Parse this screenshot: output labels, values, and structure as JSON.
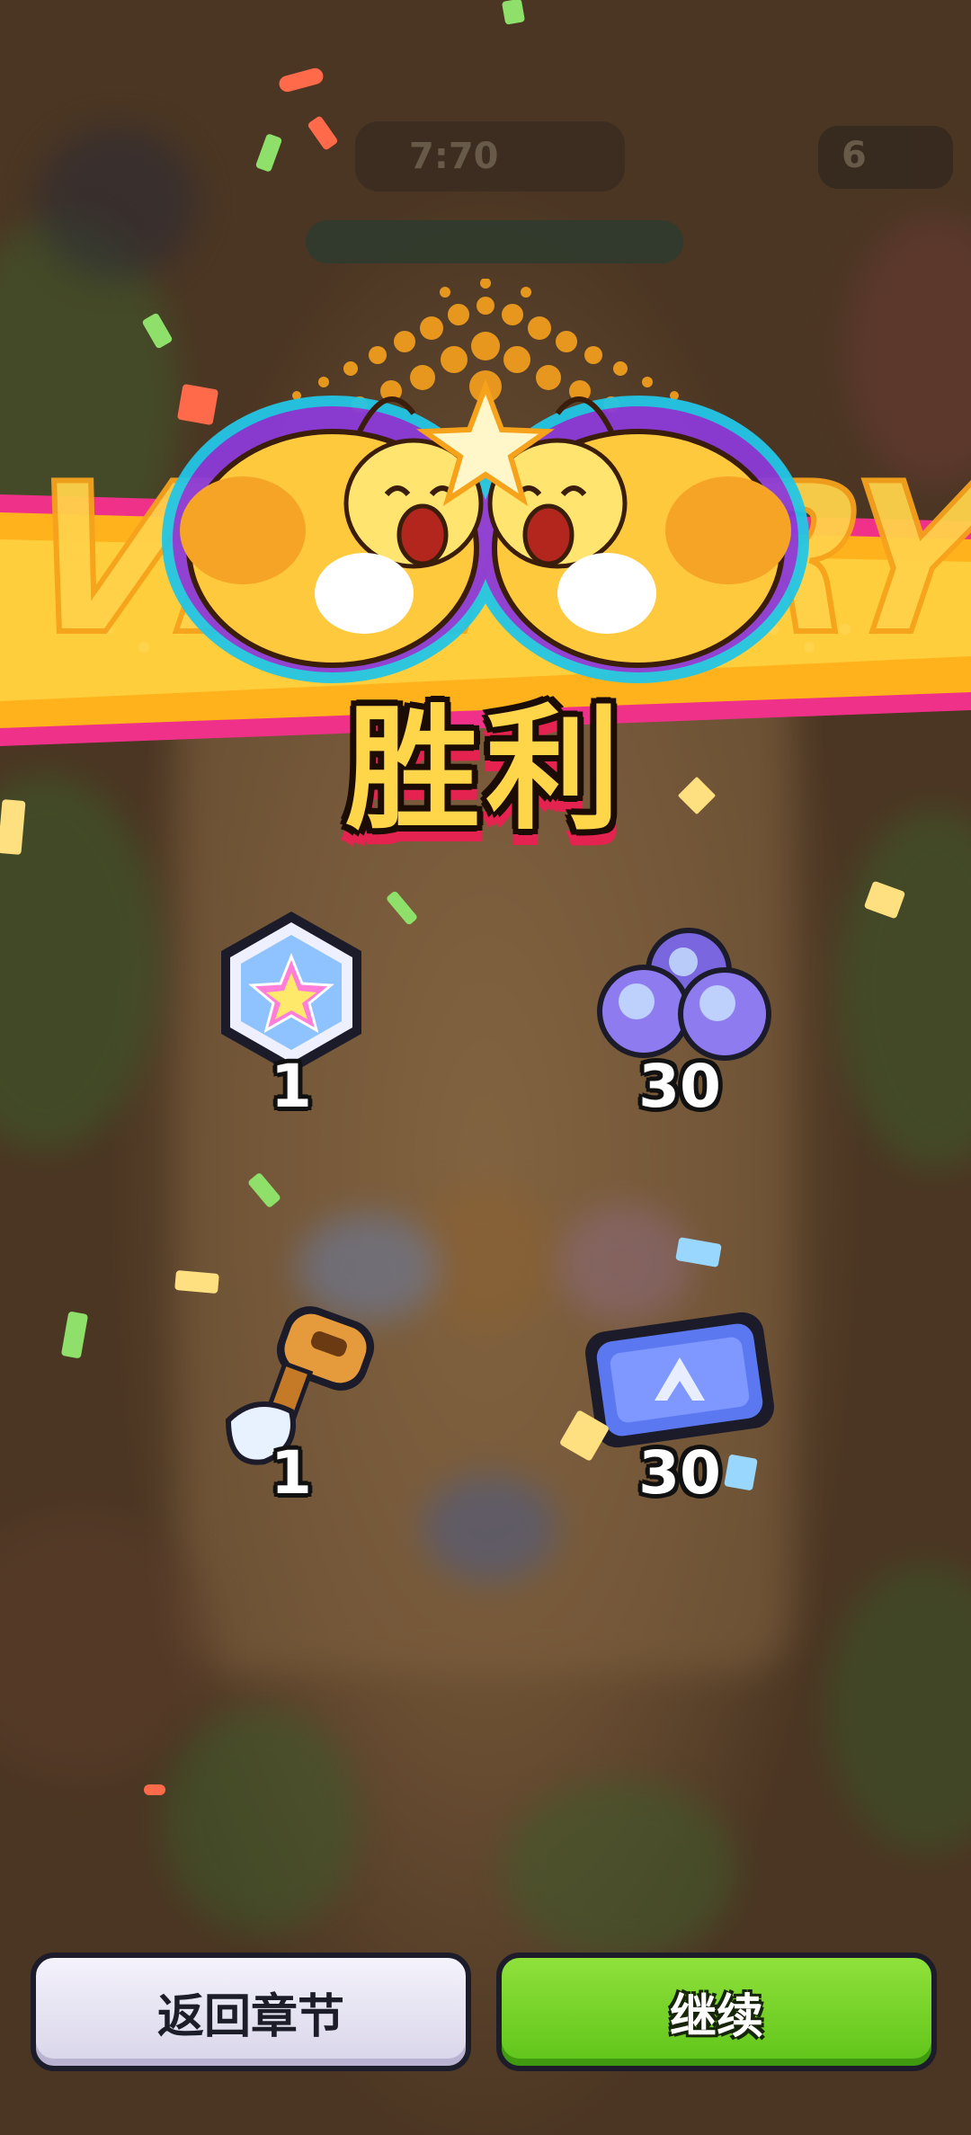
{
  "background": {
    "timer_text": "7:70",
    "lives_text": "6"
  },
  "banner": {
    "watermark": "VICTORY",
    "title": "胜利"
  },
  "rewards": [
    {
      "icon": "rainbow-star-gem-icon",
      "count": "1"
    },
    {
      "icon": "purple-orbs-icon",
      "count": "30"
    },
    {
      "icon": "golden-shovel-icon",
      "count": "1"
    },
    {
      "icon": "blue-ticket-icon",
      "count": "30"
    }
  ],
  "buttons": {
    "back_label": "返回章节",
    "continue_label": "继续"
  },
  "colors": {
    "title": "#ffd54a",
    "title_shadow": "#e42350",
    "continue_button": "#6fd024",
    "back_button": "#e8e5f4"
  }
}
